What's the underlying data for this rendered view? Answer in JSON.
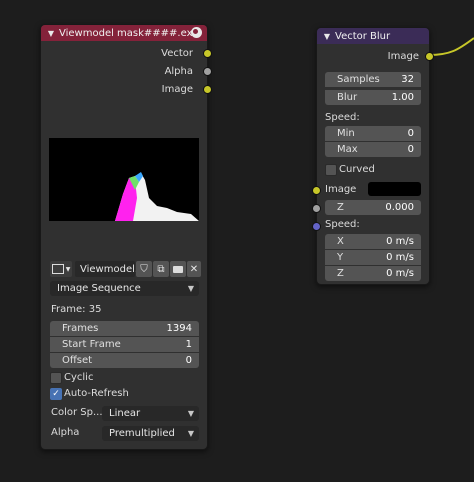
{
  "image_node": {
    "title": "Viewmodel mask####.exr",
    "header_color": "#84223a",
    "outputs": [
      {
        "label": "Vector",
        "socket_color": "#c7c729"
      },
      {
        "label": "Alpha",
        "socket_color": "#a1a1a1"
      },
      {
        "label": "Image",
        "socket_color": "#c7c729"
      }
    ],
    "image_name": "Viewmodel...",
    "source": "Image Sequence",
    "frame_label": "Frame: 35",
    "fields": {
      "frames_label": "Frames",
      "frames_value": "1394",
      "start_label": "Start Frame",
      "start_value": "1",
      "offset_label": "Offset",
      "offset_value": "0"
    },
    "cyclic_label": "Cyclic",
    "cyclic_checked": false,
    "autorefresh_label": "Auto-Refresh",
    "autorefresh_checked": true,
    "colorspace_label": "Color Sp...",
    "colorspace_value": "Linear",
    "alpha_label": "Alpha",
    "alpha_value": "Premultiplied"
  },
  "blur_node": {
    "title": "Vector Blur",
    "header_color": "#3b2c57",
    "output_label": "Image",
    "samples_label": "Samples",
    "samples_value": "32",
    "blur_label": "Blur",
    "blur_value": "1.00",
    "speed_label": "Speed:",
    "min_label": "Min",
    "min_value": "0",
    "max_label": "Max",
    "max_value": "0",
    "curved_label": "Curved",
    "curved_checked": false,
    "image_in_label": "Image",
    "z_label": "Z",
    "z_value": "0.000",
    "speed_in_label": "Speed:",
    "x_label": "X",
    "x_value": "0 m/s",
    "y_label": "Y",
    "y_value": "0 m/s",
    "sz_label": "Z",
    "sz_value": "0 m/s"
  },
  "colors": {
    "link_yellow": "#c7c729",
    "socket_vector": "#6363c7",
    "socket_grey": "#a1a1a1",
    "accent_blue": "#4772b3"
  }
}
